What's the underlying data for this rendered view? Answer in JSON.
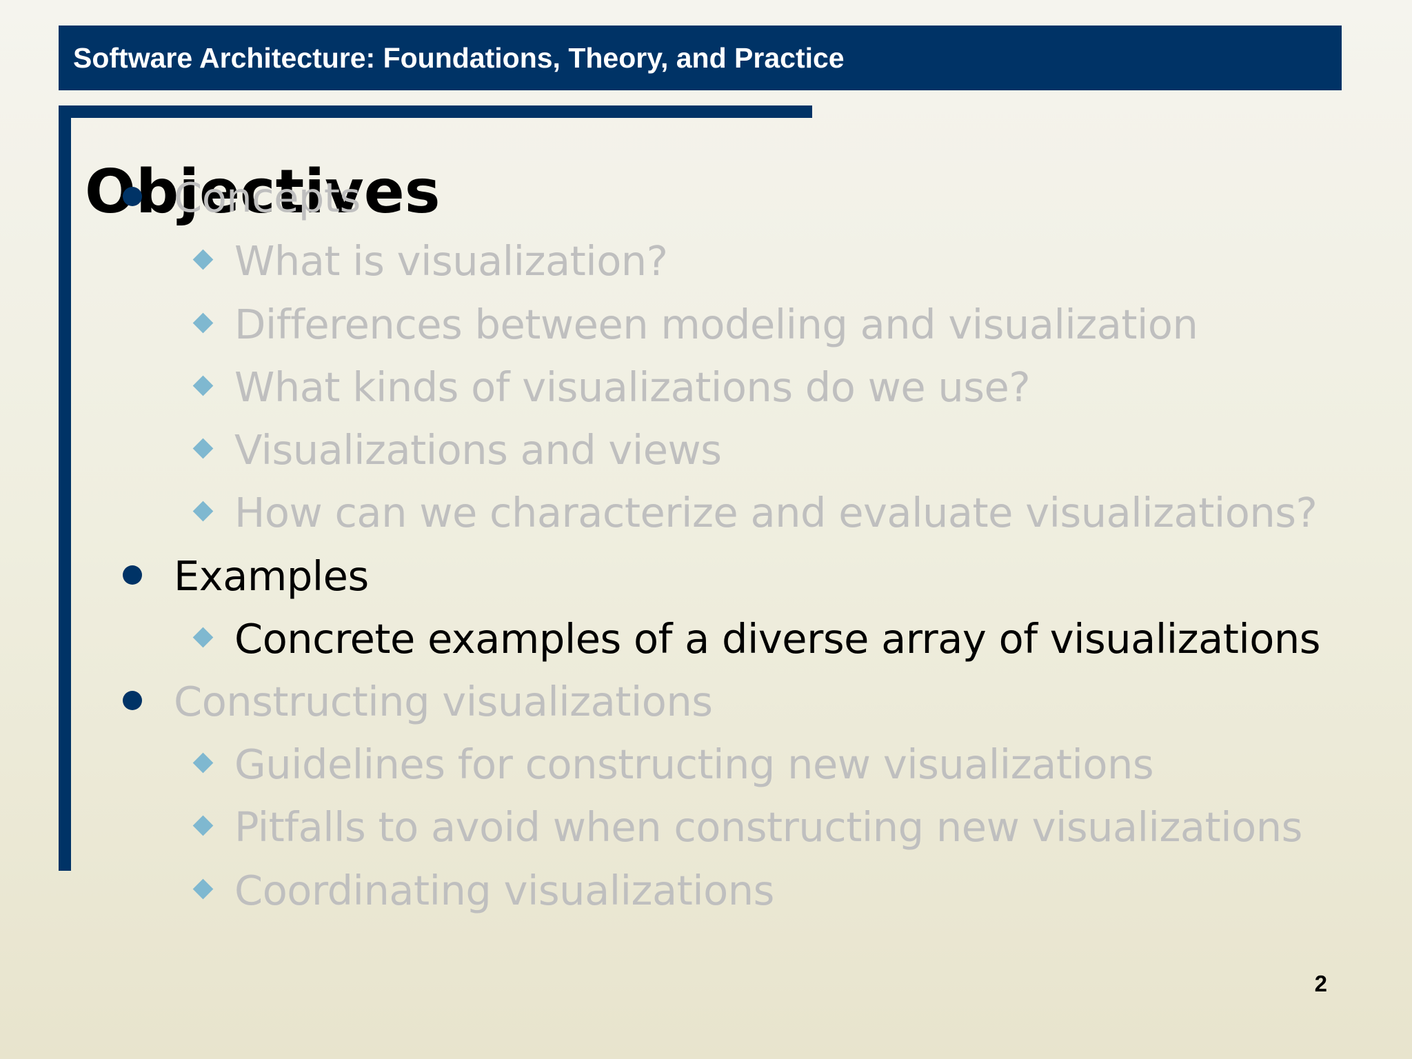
{
  "header": {
    "title": "Software Architecture: Foundations, Theory, and Practice"
  },
  "slide": {
    "title": "Objectives",
    "page_number": "2"
  },
  "bullets": [
    {
      "level": 1,
      "state": "dimmed",
      "text": "Concepts"
    },
    {
      "level": 2,
      "state": "dimmed",
      "text": "What is visualization?"
    },
    {
      "level": 2,
      "state": "dimmed",
      "text": "Differences between modeling and visualization"
    },
    {
      "level": 2,
      "state": "dimmed",
      "text": "What kinds of visualizations do we use?"
    },
    {
      "level": 2,
      "state": "dimmed",
      "text": "Visualizations and views"
    },
    {
      "level": 2,
      "state": "dimmed",
      "text": "How can we characterize and evaluate visualizations?"
    },
    {
      "level": 1,
      "state": "active",
      "text": "Examples"
    },
    {
      "level": 2,
      "state": "active",
      "text": "Concrete examples of a diverse array of visualizations"
    },
    {
      "level": 1,
      "state": "dimmed",
      "text": "Constructing visualizations"
    },
    {
      "level": 2,
      "state": "dimmed",
      "text": "Guidelines for constructing new visualizations"
    },
    {
      "level": 2,
      "state": "dimmed",
      "text": "Pitfalls to avoid when constructing new visualizations"
    },
    {
      "level": 2,
      "state": "dimmed",
      "text": "Coordinating visualizations"
    }
  ],
  "colors": {
    "brand": "#003366",
    "sub_bullet": "#7fb8d0",
    "dimmed_text": "#bfbfbf",
    "active_text": "#000000"
  }
}
